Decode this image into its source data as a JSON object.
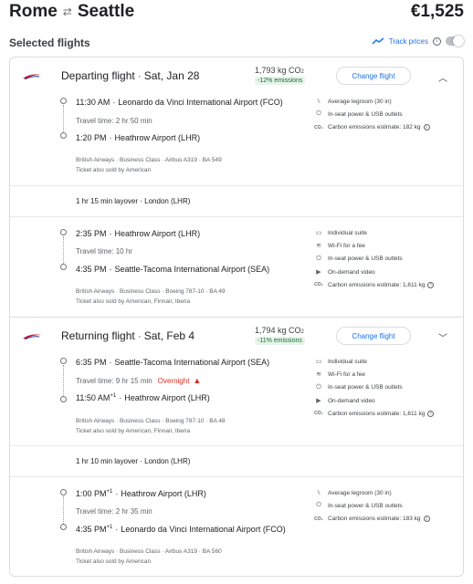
{
  "header": {
    "origin": "Rome",
    "destination": "Seattle",
    "swap_icon": "⇄",
    "price": "€1,525"
  },
  "selected": {
    "title": "Selected flights",
    "track_prices": "Track prices"
  },
  "departing": {
    "title": "Departing flight",
    "date": "Sat, Jan 28",
    "emissions": "1,793 kg CO",
    "emissions_sub": "2",
    "emissions_badge": "-12% emissions",
    "change_label": "Change flight",
    "seg1": {
      "dep_time": "11:30 AM",
      "dep_airport": "Leonardo da Vinci International Airport (FCO)",
      "travel": "Travel time: 2 hr 50 min",
      "arr_time": "1:20 PM",
      "arr_airport": "Heathrow Airport (LHR)",
      "meta1": "British Airways · Business Class · Airbus A319 · BA 549",
      "meta2": "Ticket also sold by American",
      "amenities": [
        "Average legroom (30 in)",
        "In-seat power & USB outlets",
        "Carbon emissions estimate: 182 kg"
      ]
    },
    "layover": "1 hr 15 min layover · London (LHR)",
    "seg2": {
      "dep_time": "2:35 PM",
      "dep_airport": "Heathrow Airport (LHR)",
      "travel": "Travel time: 10 hr",
      "arr_time": "4:35 PM",
      "arr_airport": "Seattle-Tacoma International Airport (SEA)",
      "meta1": "British Airways · Business Class · Boeing 787-10 · BA 49",
      "meta2": "Ticket also sold by American, Finnair, Iberia",
      "amenities": [
        "Individual suite",
        "Wi-Fi for a fee",
        "In-seat power & USB outlets",
        "On-demand video",
        "Carbon emissions estimate: 1,611 kg"
      ]
    }
  },
  "returning": {
    "title": "Returning flight",
    "date": "Sat, Feb 4",
    "emissions": "1,794 kg CO",
    "emissions_sub": "2",
    "emissions_badge": "-11% emissions",
    "change_label": "Change flight",
    "seg1": {
      "dep_time": "6:35 PM",
      "dep_airport": "Seattle-Tacoma International Airport (SEA)",
      "travel": "Travel time: 9 hr 15 min",
      "overnight": "Overnight",
      "arr_time": "11:50 AM",
      "arr_sup": "+1",
      "arr_airport": "Heathrow Airport (LHR)",
      "meta1": "British Airways · Business Class · Boeing 787-10 · BA 48",
      "meta2": "Ticket also sold by American, Finnair, Iberia",
      "amenities": [
        "Individual suite",
        "Wi-Fi for a fee",
        "In-seat power & USB outlets",
        "On-demand video",
        "Carbon emissions estimate: 1,611 kg"
      ]
    },
    "layover": "1 hr 10 min layover · London (LHR)",
    "seg2": {
      "dep_time": "1:00 PM",
      "dep_sup": "+1",
      "dep_airport": "Heathrow Airport (LHR)",
      "travel": "Travel time: 2 hr 35 min",
      "arr_time": "4:35 PM",
      "arr_sup": "+1",
      "arr_airport": "Leonardo da Vinci International Airport (FCO)",
      "meta1": "British Airways · Business Class · Airbus A319 · BA 560",
      "meta2": "Ticket also sold by American",
      "amenities": [
        "Average legroom (30 in)",
        "In-seat power & USB outlets",
        "Carbon emissions estimate: 183 kg"
      ]
    }
  }
}
